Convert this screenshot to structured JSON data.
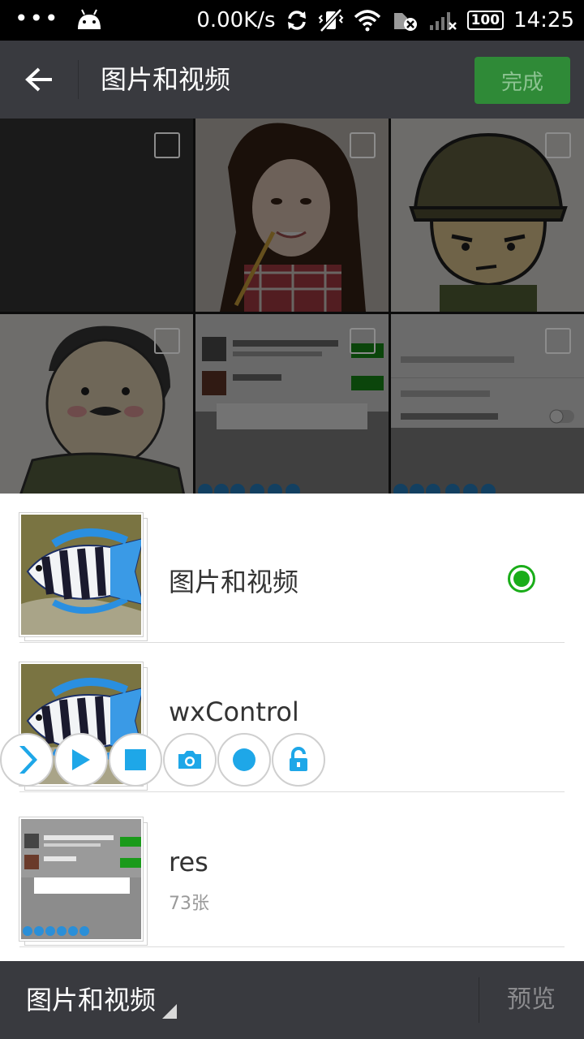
{
  "status_bar": {
    "net_speed": "0.00K/s",
    "battery": "100",
    "time": "14:25",
    "icons": [
      "more-dots-icon",
      "android-icon",
      "sync-icon",
      "vibrate-off-icon",
      "wifi-icon",
      "sim-error-icon",
      "signal-icon",
      "battery-icon"
    ]
  },
  "header": {
    "title": "图片和视频",
    "done_label": "完成"
  },
  "albums": [
    {
      "name": "图片和视频",
      "count": "",
      "selected": true
    },
    {
      "name": "wxControl",
      "count": "",
      "selected": false
    },
    {
      "name": "res",
      "count": "73张",
      "selected": false
    }
  ],
  "float_controls": [
    "expand-icon",
    "play-icon",
    "stop-icon",
    "camera-icon",
    "record-icon",
    "unlock-icon"
  ],
  "bottom_bar": {
    "album_label": "图片和视频",
    "preview_label": "预览"
  },
  "colors": {
    "accent_green": "#1aad19",
    "done_button": "#2f8a37",
    "bar_bg": "#393a3f",
    "float_icon": "#1ea7e8"
  }
}
